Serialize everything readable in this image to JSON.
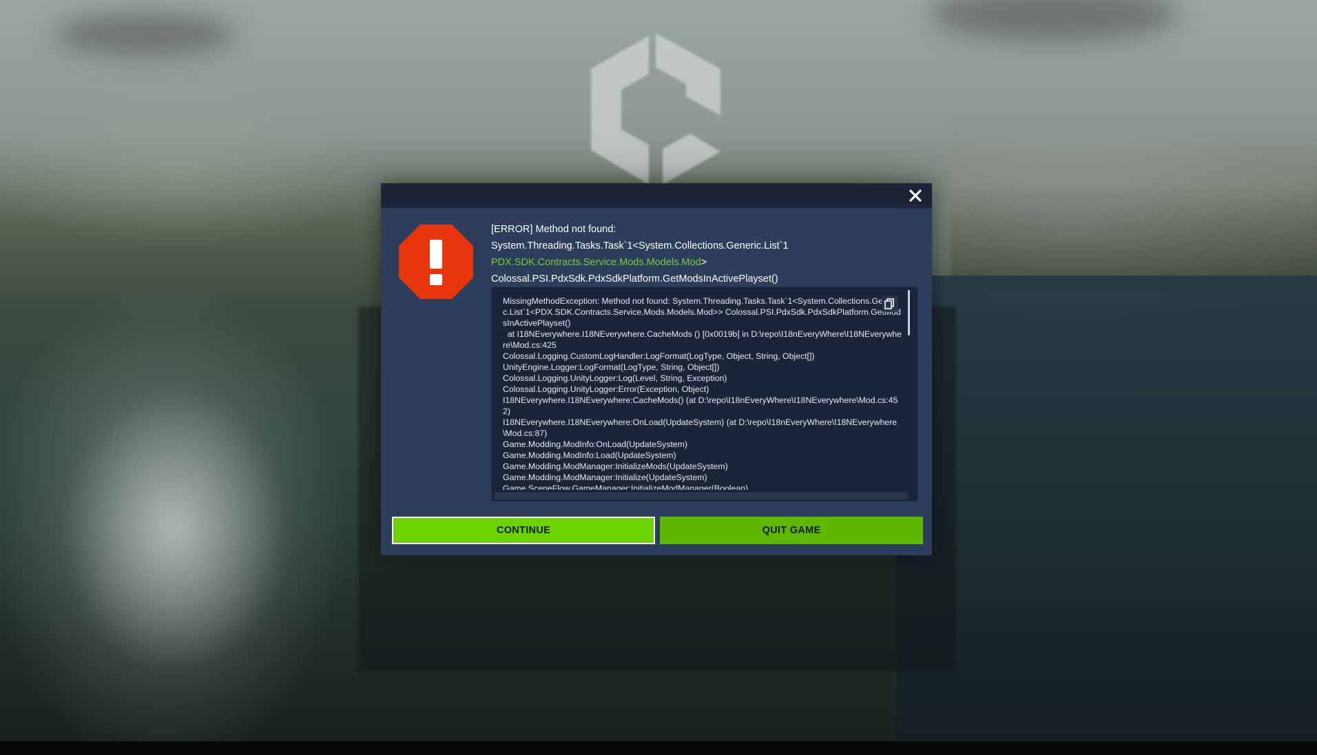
{
  "dialog": {
    "close_icon": "close-x-icon",
    "error_icon": "error-octagon-icon",
    "title_line1": "[ERROR] Method not found:",
    "title_line2": "System.Threading.Tasks.Task`1<System.Collections.Generic.List`1",
    "title_line3_green": "PDX.SDK.Contracts.Service.Mods.Models.Mod",
    "title_line3_rest": ">",
    "title_line4": "Colossal.PSI.PdxSdk.PdxSdkPlatform.GetModsInActivePlayset()",
    "log_text": "MissingMethodException: Method not found: System.Threading.Tasks.Task`1<System.Collections.Generic.List`1<PDX.SDK.Contracts.Service.Mods.Models.Mod>> Colossal.PSI.PdxSdk.PdxSdkPlatform.GetModsInActivePlayset()\n  at I18NEverywhere.I18NEverywhere.CacheMods () [0x0019b] in D:\\repo\\I18nEveryWhere\\I18NEverywhere\\Mod.cs:425\nColossal.Logging.CustomLogHandler:LogFormat(LogType, Object, String, Object[])\nUnityEngine.Logger:LogFormat(LogType, String, Object[])\nColossal.Logging.UnityLogger:Log(Level, String, Exception)\nColossal.Logging.UnityLogger:Error(Exception, Object)\nI18NEverywhere.I18NEverywhere:CacheMods() (at D:\\repo\\I18nEveryWhere\\I18NEverywhere\\Mod.cs:452)\nI18NEverywhere.I18NEverywhere:OnLoad(UpdateSystem) (at D:\\repo\\I18nEveryWhere\\I18NEverywhere\\Mod.cs:87)\nGame.Modding.ModInfo:OnLoad(UpdateSystem)\nGame.Modding.ModInfo:Load(UpdateSystem)\nGame.Modding.ModManager:InitializeMods(UpdateSystem)\nGame.Modding.ModManager:Initialize(UpdateSystem)\nGame.SceneFlow.GameManager:InitializeModManager(Boolean)",
    "copy_icon": "copy-icon",
    "continue_label": "CONTINUE",
    "quit_label": "QUIT GAME"
  },
  "colors": {
    "dialog_bg": "#2c3e5c",
    "header_bg": "#1c2536",
    "log_bg": "#1b253a",
    "accent_green": "#6cd200",
    "error_red": "#e8360c",
    "highlight_text": "#77cc33"
  }
}
